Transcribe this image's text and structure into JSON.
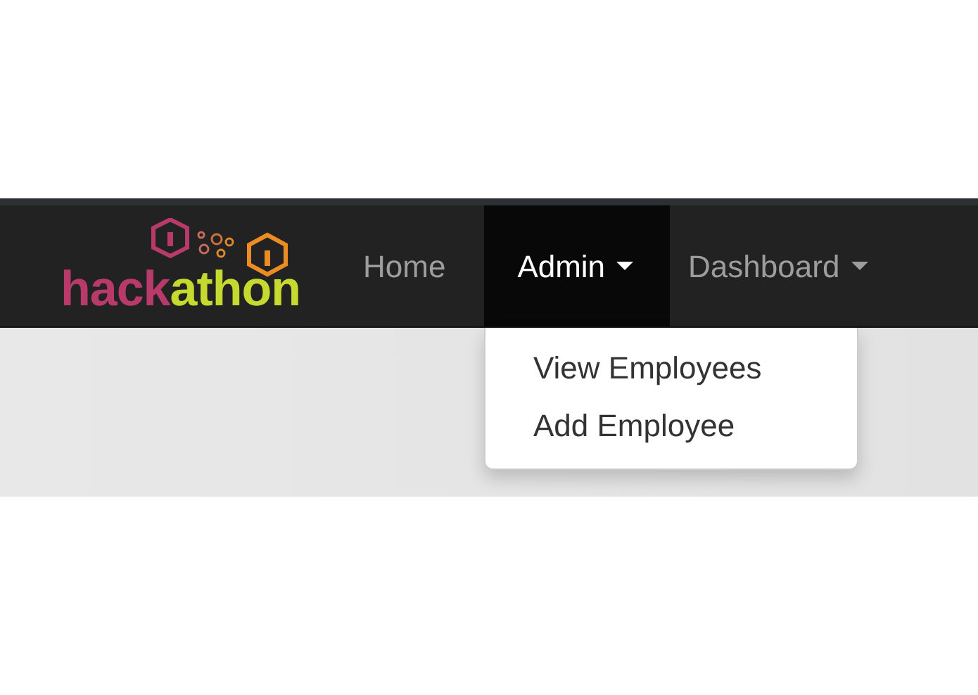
{
  "logo": {
    "parts": [
      {
        "text": "hack",
        "color": "#b83a6b"
      },
      {
        "text": "athon",
        "color": "#c5d92e"
      }
    ]
  },
  "nav": [
    {
      "label": "Home",
      "kind": "link",
      "selected": false
    },
    {
      "label": "Admin",
      "kind": "dropdown",
      "selected": true,
      "menu": [
        "View Employees",
        "Add Employee"
      ]
    },
    {
      "label": "Dashboard",
      "kind": "dropdown",
      "selected": false
    }
  ]
}
